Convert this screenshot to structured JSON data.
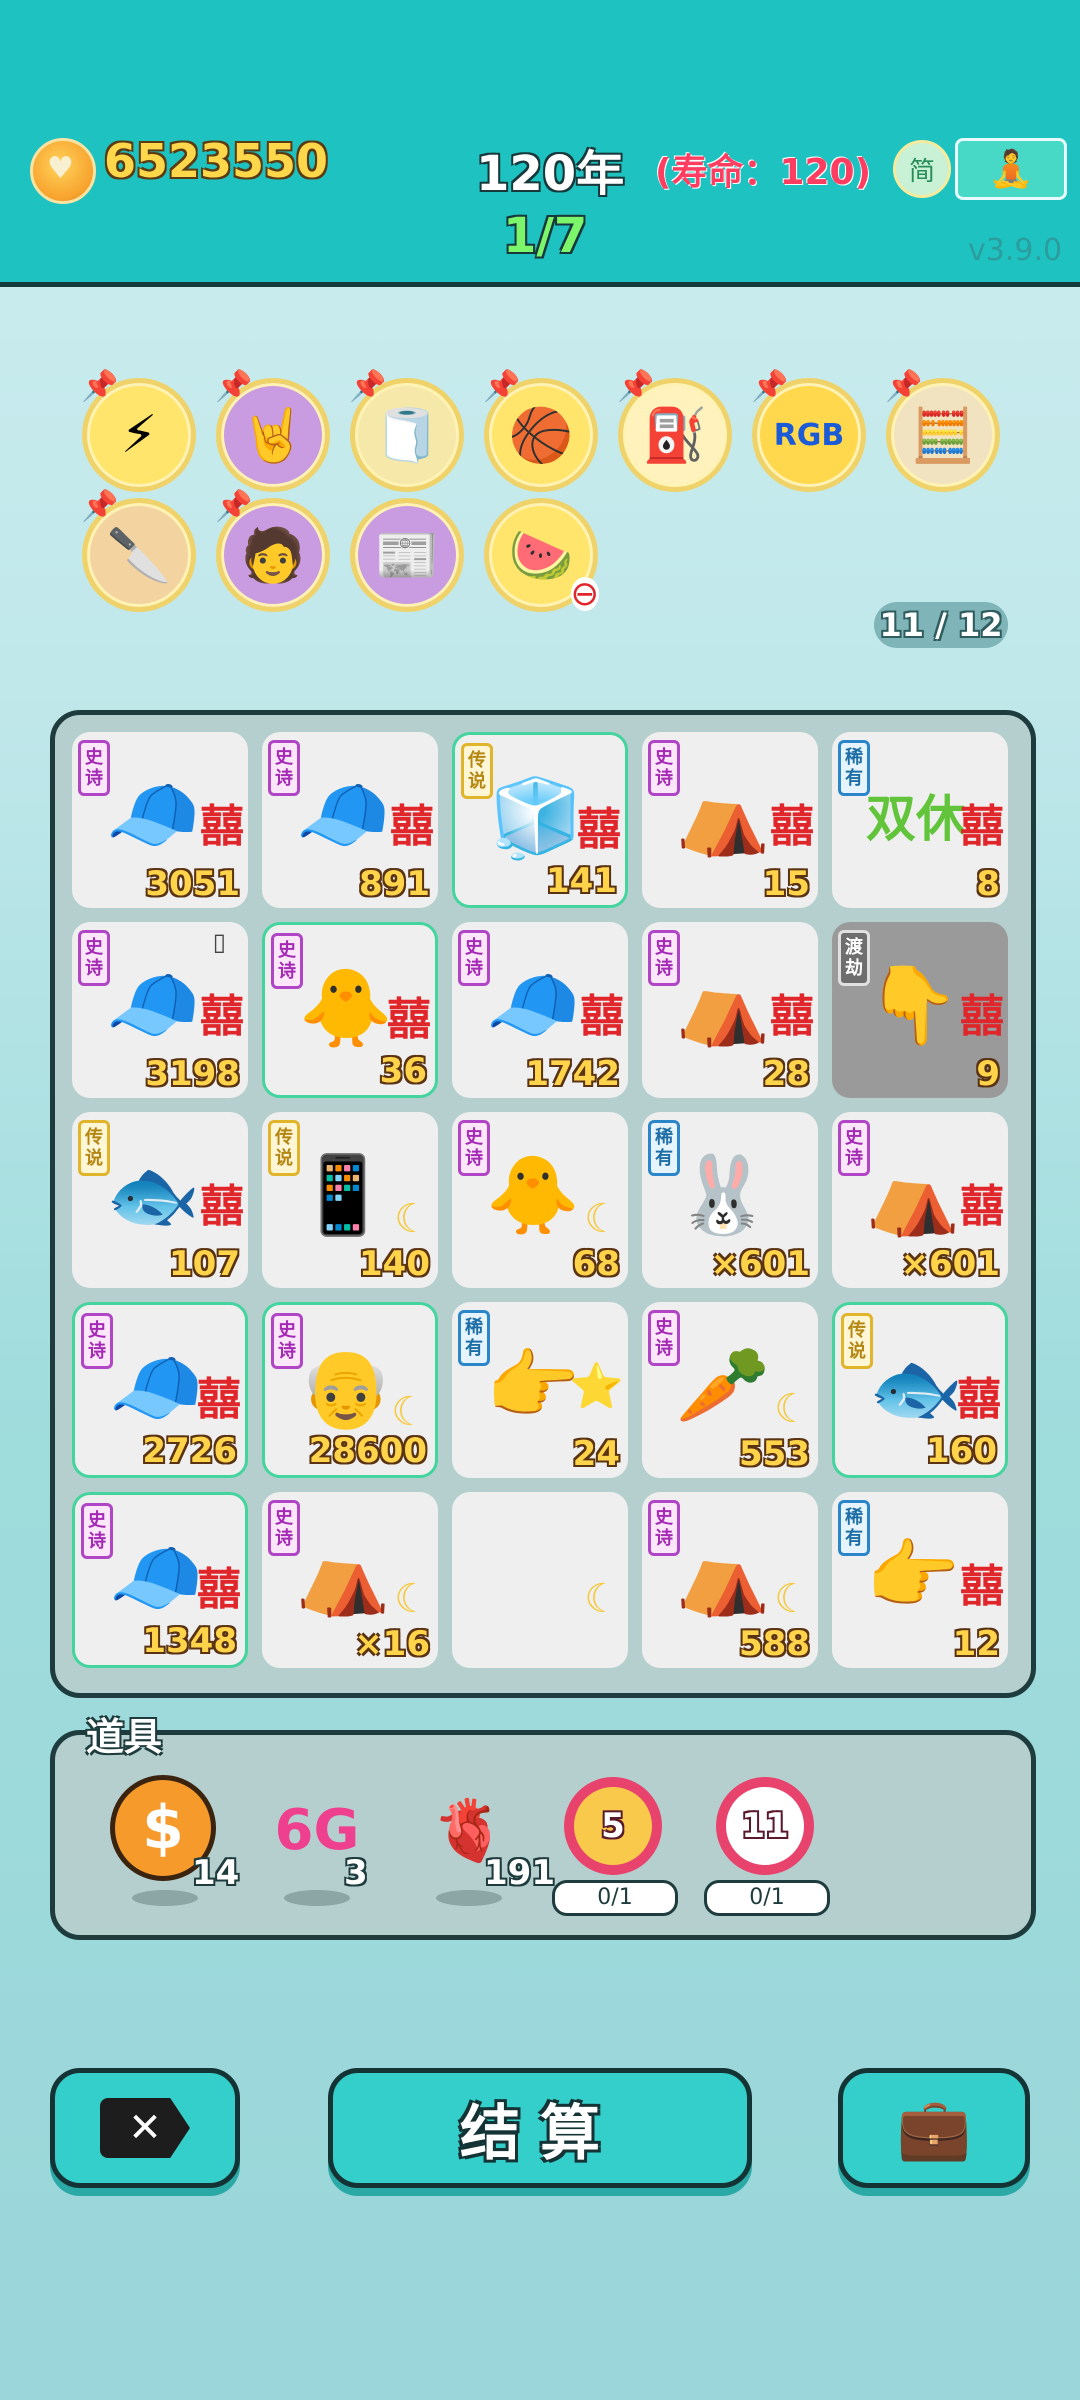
{
  "header": {
    "money": "6523550",
    "year": "120年",
    "lifespan": "(寿命：120)",
    "round": "1/7",
    "simplified_label": "简",
    "version": "v3.9.0"
  },
  "buffs": {
    "items": [
      {
        "icon": "lightning-icon",
        "glyph": "⚡",
        "bg": "#ffe56b",
        "pinned": true
      },
      {
        "icon": "rock-hand-icon",
        "glyph": "🤘",
        "bg": "#c99be0",
        "pinned": true
      },
      {
        "icon": "tissue-box-icon",
        "glyph": "🧻",
        "bg": "#f6e8a8",
        "pinned": true
      },
      {
        "icon": "basketballs-icon",
        "glyph": "🏀",
        "bg": "#ffe56b",
        "pinned": true
      },
      {
        "icon": "air-pump-icon",
        "glyph": "⛽",
        "bg": "#fff2bd",
        "pinned": true
      },
      {
        "icon": "rgb-ball-icon",
        "glyph": "RGB",
        "bg": "#ffd84d",
        "pinned": true
      },
      {
        "icon": "math-guy-icon",
        "glyph": "🧮",
        "bg": "#f2e3c0",
        "pinned": true
      },
      {
        "icon": "cleaver-icon",
        "glyph": "🔪",
        "bg": "#f3d4a0",
        "pinned": true
      },
      {
        "icon": "math-guy-green-icon",
        "glyph": "🧑",
        "bg": "#c99be0",
        "pinned": true
      },
      {
        "icon": "time-magazine-icon",
        "glyph": "📰",
        "bg": "#c99be0",
        "pinned": false
      },
      {
        "icon": "fruit-bowl-icon",
        "glyph": "🍉",
        "bg": "#ffe56b",
        "pinned": false
      }
    ],
    "counter": "11 / 12"
  },
  "board": {
    "cells": [
      {
        "tag": "史诗",
        "tagType": "epic",
        "icon": "green-hat-man-icon",
        "glyph": "🧢",
        "xi": "囍",
        "count": "3051",
        "glow": false
      },
      {
        "tag": "史诗",
        "tagType": "epic",
        "icon": "green-hat-man-icon",
        "glyph": "🧢",
        "xi": "囍",
        "count": "891",
        "glow": false
      },
      {
        "tag": "传说",
        "tagType": "legend",
        "icon": "fridge-icon",
        "glyph": "🧊",
        "xi": "囍",
        "count": "141",
        "glow": true
      },
      {
        "tag": "史诗",
        "tagType": "epic",
        "icon": "rabbit-tent-icon",
        "glyph": "⛺",
        "xi": "囍",
        "count": "15",
        "glow": false
      },
      {
        "tag": "稀有",
        "tagType": "rare",
        "icon": "double-rest-icon",
        "glyph": "双休",
        "xi": "囍",
        "count": "8",
        "glow": false
      },
      {
        "tag": "史诗",
        "tagType": "epic",
        "icon": "green-hat-man-icon",
        "glyph": "🧢",
        "xi": "囍",
        "count": "3198",
        "glow": false,
        "phone": true
      },
      {
        "tag": "史诗",
        "tagType": "epic",
        "icon": "gray-hair-chick-icon",
        "glyph": "🐥",
        "xi": "囍",
        "count": "36",
        "glow": true
      },
      {
        "tag": "史诗",
        "tagType": "epic",
        "icon": "green-hat-man-icon",
        "glyph": "🧢",
        "xi": "囍",
        "count": "1742",
        "glow": false
      },
      {
        "tag": "史诗",
        "tagType": "epic",
        "icon": "rabbit-tent-icon",
        "glyph": "⛺",
        "xi": "囍",
        "count": "28",
        "glow": false
      },
      {
        "tag": "渡劫",
        "tagType": "jie",
        "icon": "yellow-finger-icon",
        "glyph": "👇",
        "xi": "囍",
        "count": "9",
        "glow": false,
        "gray": true
      },
      {
        "tag": "传说",
        "tagType": "legend",
        "icon": "koi-fish-icon",
        "glyph": "🐟",
        "xi": "囍",
        "count": "107",
        "glow": false
      },
      {
        "tag": "传说",
        "tagType": "legend",
        "icon": "smartphone-icon",
        "glyph": "📱",
        "xi": "",
        "moon": true,
        "count": "140",
        "glow": false
      },
      {
        "tag": "史诗",
        "tagType": "epic",
        "icon": "gray-hair-chick-icon",
        "glyph": "🐥",
        "xi": "",
        "moon": true,
        "count": "68",
        "glow": false
      },
      {
        "tag": "稀有",
        "tagType": "rare",
        "icon": "rabbit-icon",
        "glyph": "🐰",
        "xi": "",
        "count": "×601",
        "glow": false
      },
      {
        "tag": "史诗",
        "tagType": "epic",
        "icon": "rabbit-tent-icon",
        "glyph": "⛺",
        "xi": "囍",
        "count": "×601",
        "glow": false
      },
      {
        "tag": "史诗",
        "tagType": "epic",
        "icon": "green-hat-man-icon",
        "glyph": "🧢",
        "xi": "囍",
        "count": "2726",
        "glow": true
      },
      {
        "tag": "史诗",
        "tagType": "epic",
        "icon": "bearded-old-man-icon",
        "glyph": "👴",
        "xi": "",
        "moon": true,
        "count": "28600",
        "glow": true
      },
      {
        "tag": "稀有",
        "tagType": "rare",
        "icon": "pointing-finger-star-icon",
        "glyph": "👉",
        "xi": "⭐",
        "count": "24",
        "glow": false
      },
      {
        "tag": "史诗",
        "tagType": "epic",
        "icon": "carrot-icon",
        "glyph": "🥕",
        "xi": "",
        "moon": true,
        "count": "553",
        "glow": false
      },
      {
        "tag": "传说",
        "tagType": "legend",
        "icon": "koi-fish-icon",
        "glyph": "🐟",
        "xi": "囍",
        "count": "160",
        "glow": true
      },
      {
        "tag": "史诗",
        "tagType": "epic",
        "icon": "green-hat-man-icon",
        "glyph": "🧢",
        "xi": "囍",
        "count": "1348",
        "glow": true
      },
      {
        "tag": "史诗",
        "tagType": "epic",
        "icon": "rabbit-tent-icon",
        "glyph": "⛺",
        "xi": "",
        "moon": true,
        "count": "×16",
        "glow": false
      },
      {
        "tag": "",
        "tagType": "",
        "icon": "moon-icon",
        "glyph": "",
        "xi": "",
        "moon": true,
        "count": "",
        "glow": false
      },
      {
        "tag": "史诗",
        "tagType": "epic",
        "icon": "rabbit-tent-icon",
        "glyph": "⛺",
        "xi": "",
        "moon": true,
        "count": "588",
        "glow": false
      },
      {
        "tag": "稀有",
        "tagType": "rare",
        "icon": "pointing-finger-icon",
        "glyph": "👉",
        "xi": "囍",
        "count": "12",
        "glow": false
      }
    ]
  },
  "props": {
    "title": "道具",
    "items": [
      {
        "icon": "dollar-coin-icon",
        "glyph": "$",
        "count": "14"
      },
      {
        "icon": "6g-icon",
        "glyph": "6G",
        "count": "3"
      },
      {
        "icon": "liver-icon",
        "glyph": "🫀",
        "count": "191"
      }
    ],
    "rings": [
      {
        "icon": "coins-ring-icon",
        "value": "5",
        "button": "0/1"
      },
      {
        "icon": "target-ring-icon",
        "value": "11",
        "button": "0/1"
      }
    ]
  },
  "actions": {
    "close_glyph": "✕",
    "settle_label": "结算",
    "bag_glyph": "💼"
  }
}
